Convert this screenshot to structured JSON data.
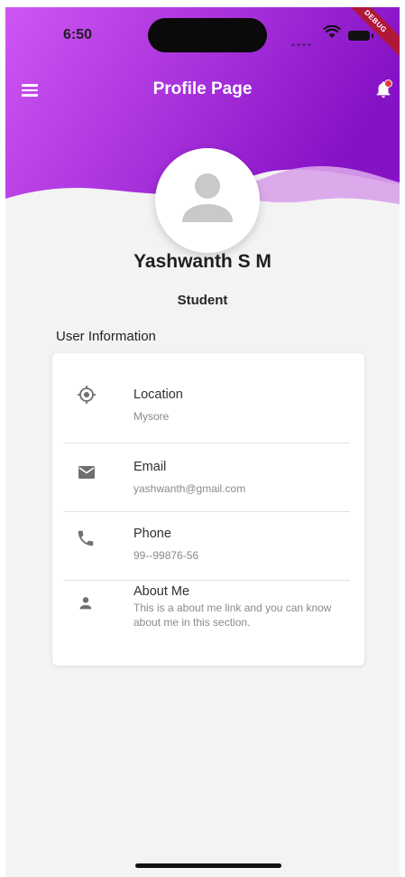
{
  "status_bar": {
    "time": "6:50",
    "debug_label": "DEBUG"
  },
  "appbar": {
    "title": "Profile Page"
  },
  "colors": {
    "gradient_start": "#c94ef0",
    "gradient_end": "#8a15c8",
    "wave_light": "#d79be9"
  },
  "profile": {
    "name": "Yashwanth S M",
    "role": "Student"
  },
  "section": {
    "title": "User Information"
  },
  "info_rows": [
    {
      "icon": "location-target-icon",
      "label": "Location",
      "value": "Mysore"
    },
    {
      "icon": "email-icon",
      "label": "Email",
      "value": "yashwanth@gmail.com"
    },
    {
      "icon": "phone-icon",
      "label": "Phone",
      "value": "99--99876-56"
    },
    {
      "icon": "person-icon",
      "label": "About Me",
      "value": "This is a about me link and you can know about me in this section."
    }
  ]
}
